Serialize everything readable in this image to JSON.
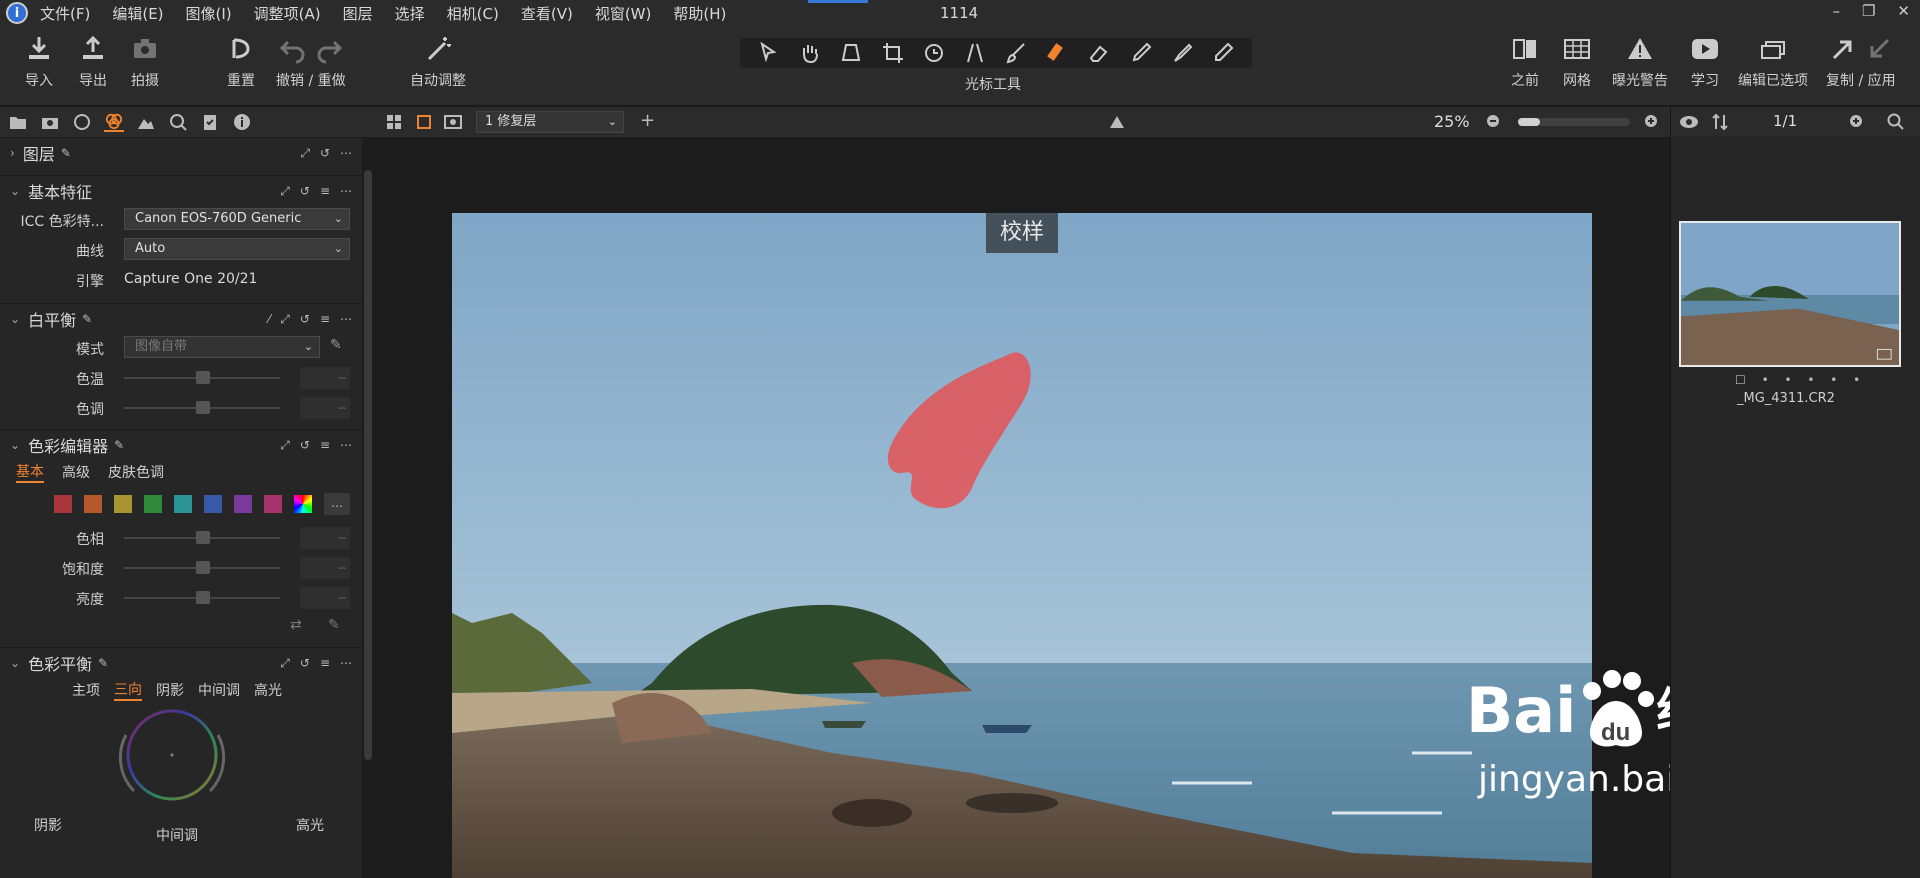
{
  "menu": {
    "items": [
      "文件(F)",
      "编辑(E)",
      "图像(I)",
      "调整项(A)",
      "图层",
      "选择",
      "相机(C)",
      "查看(V)",
      "视窗(W)",
      "帮助(H)"
    ],
    "window_title": "1114",
    "controls": [
      "–",
      "❐",
      "✕"
    ]
  },
  "toolbar": {
    "import": "导入",
    "export": "导出",
    "capture": "拍摄",
    "reset": "重置",
    "undo_redo": "撤销 / 重做",
    "auto_adjust": "自动调整",
    "cursor_tools": "光标工具",
    "before": "之前",
    "grid": "网格",
    "exposure_warning": "曝光警告",
    "learn": "学习",
    "edit_selected": "编辑已选项",
    "copy_apply": "复制 / 应用"
  },
  "layers": {
    "title": "图层"
  },
  "basic": {
    "title": "基本特征",
    "icc_label": "ICC 色彩特...",
    "icc_value": "Canon EOS-760D Generic",
    "curve_label": "曲线",
    "curve_value": "Auto",
    "engine_label": "引擎",
    "engine_value": "Capture One 20/21"
  },
  "white_balance": {
    "title": "白平衡",
    "mode_label": "模式",
    "mode_value": "图像自带",
    "temp_label": "色温",
    "tint_label": "色调",
    "placeholder": "--"
  },
  "color_editor": {
    "title": "色彩编辑器",
    "tabs": [
      "基本",
      "高级",
      "皮肤色调"
    ],
    "swatch_colors": [
      "#a8363a",
      "#b5582e",
      "#a89430",
      "#2f8a3a",
      "#2a9494",
      "#3858a8",
      "#7a3a9a",
      "#a8346e"
    ],
    "more": "...",
    "hue_label": "色相",
    "sat_label": "饱和度",
    "light_label": "亮度"
  },
  "color_balance": {
    "title": "色彩平衡",
    "tabs": [
      "主项",
      "三向",
      "阴影",
      "中间调",
      "高光"
    ],
    "shadow": "阴影",
    "midtone": "中间调",
    "highlight": "高光"
  },
  "viewer": {
    "variant": "1 修复层",
    "zoom": "25%",
    "proof_label": "校样",
    "count": "1/1"
  },
  "browser": {
    "filename": "_MG_4311.CR2",
    "rating": "☐ • • • • •"
  },
  "watermark": {
    "brand_latin": "Bai",
    "brand_du": "du",
    "brand_cn": "经验",
    "url": "jingyan.baidu.com"
  }
}
